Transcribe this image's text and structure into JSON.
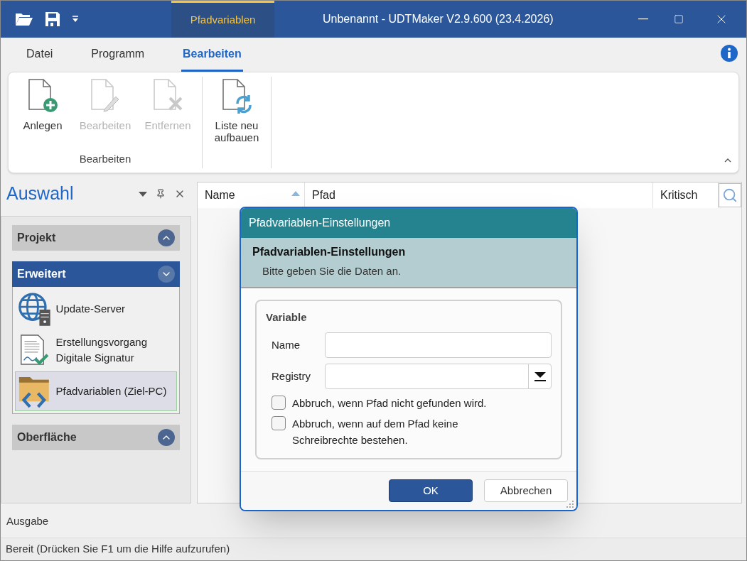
{
  "context_tab": {
    "label": "Pfadvariablen"
  },
  "window": {
    "title": "Unbenannt - UDTMaker V2.9.600 (23.4.2026)"
  },
  "ribbon_tabs": [
    {
      "label": "Datei",
      "selected": false
    },
    {
      "label": "Programm",
      "selected": false
    },
    {
      "label": "Bearbeiten",
      "selected": true
    }
  ],
  "ribbon_groups": [
    {
      "label": "Bearbeiten",
      "buttons": [
        {
          "label": "Anlegen",
          "kind": "add",
          "disabled": false
        },
        {
          "label": "Bearbeiten",
          "kind": "edit",
          "disabled": true
        },
        {
          "label": "Entfernen",
          "kind": "remove",
          "disabled": true
        }
      ]
    },
    {
      "buttons": [
        {
          "label": "Liste neu aufbauen",
          "kind": "refresh",
          "disabled": false
        }
      ]
    }
  ],
  "sidebar": {
    "title": "Auswahl",
    "sections": [
      {
        "label": "Projekt",
        "expanded": false
      },
      {
        "label": "Erweitert",
        "expanded": true,
        "items": [
          {
            "label": "Update-Server",
            "kind": "server",
            "selected": false
          },
          {
            "label": "Erstellungsvorgang Digitale Signatur",
            "kind": "signature",
            "selected": false
          },
          {
            "label": "Pfadvariablen (Ziel-PC)",
            "kind": "folder",
            "selected": true
          }
        ]
      },
      {
        "label": "Oberfläche",
        "expanded": false
      }
    ]
  },
  "table": {
    "columns": [
      {
        "label": "Name",
        "sorted": true
      },
      {
        "label": "Pfad",
        "sorted": false
      },
      {
        "label": "Kritisch",
        "sorted": false
      }
    ]
  },
  "dialog": {
    "title": "Pfadvariablen-Einstellungen",
    "header_title": "Pfadvariablen-Einstellungen",
    "header_subtitle": "Bitte geben Sie die Daten an.",
    "group_label": "Variable",
    "fields": [
      {
        "label": "Name",
        "kind": "text"
      },
      {
        "label": "Registry",
        "kind": "dropdown"
      }
    ],
    "checkboxes": [
      {
        "label": "Abbruch, wenn Pfad nicht gefunden wird.",
        "checked": false
      },
      {
        "label": "Abbruch, wenn auf dem Pfad keine Schreibrechte bestehen.",
        "checked": false
      }
    ],
    "buttons": [
      {
        "label": "OK",
        "kind": "primary"
      },
      {
        "label": "Abbrechen",
        "kind": "secondary"
      }
    ]
  },
  "output_panel": {
    "title": "Ausgabe"
  },
  "status_bar": {
    "text": "Bereit (Drücken Sie F1 um die Hilfe aufzurufen)"
  }
}
